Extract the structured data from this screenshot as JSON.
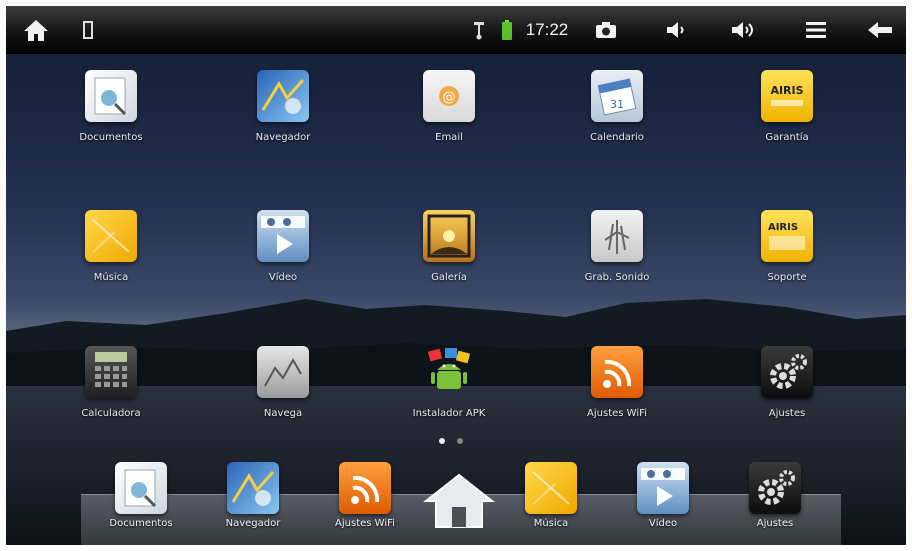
{
  "status_bar": {
    "time": "17:22",
    "icons": [
      "home-icon",
      "sd-card-icon",
      "usb-icon",
      "battery-icon",
      "camera-icon",
      "volume-down-icon",
      "volume-up-icon",
      "menu-icon",
      "back-icon"
    ]
  },
  "apps": [
    {
      "label": "Documentos",
      "icon": "documents-icon"
    },
    {
      "label": "Navegador",
      "icon": "browser-icon"
    },
    {
      "label": "Email",
      "icon": "email-icon"
    },
    {
      "label": "Calendario",
      "icon": "calendar-icon"
    },
    {
      "label": "Garantía",
      "icon": "airis-warranty-icon"
    },
    {
      "label": "Música",
      "icon": "music-icon"
    },
    {
      "label": "Vídeo",
      "icon": "video-icon"
    },
    {
      "label": "Galería",
      "icon": "gallery-icon"
    },
    {
      "label": "Grab. Sonido",
      "icon": "sound-recorder-icon"
    },
    {
      "label": "Soporte",
      "icon": "airis-support-icon"
    },
    {
      "label": "Calculadora",
      "icon": "calculator-icon"
    },
    {
      "label": "Navega",
      "icon": "navega-icon"
    },
    {
      "label": "Instalador APK",
      "icon": "apk-installer-icon"
    },
    {
      "label": "Ajustes WiFi",
      "icon": "wifi-settings-icon"
    },
    {
      "label": "Ajustes",
      "icon": "settings-icon"
    }
  ],
  "dock": [
    {
      "label": "Documentos",
      "icon": "documents-icon"
    },
    {
      "label": "Navegador",
      "icon": "browser-icon"
    },
    {
      "label": "Ajustes WiFi",
      "icon": "wifi-settings-icon"
    },
    {
      "label": "Música",
      "icon": "music-icon"
    },
    {
      "label": "Vídeo",
      "icon": "video-icon"
    },
    {
      "label": "Ajustes",
      "icon": "settings-icon"
    }
  ],
  "page_indicator": {
    "pages": 2,
    "current": 1
  },
  "colors": {
    "status_bar": "#111111",
    "wifi_orange": "#f07a10",
    "airis_yellow": "#f7c51c"
  }
}
